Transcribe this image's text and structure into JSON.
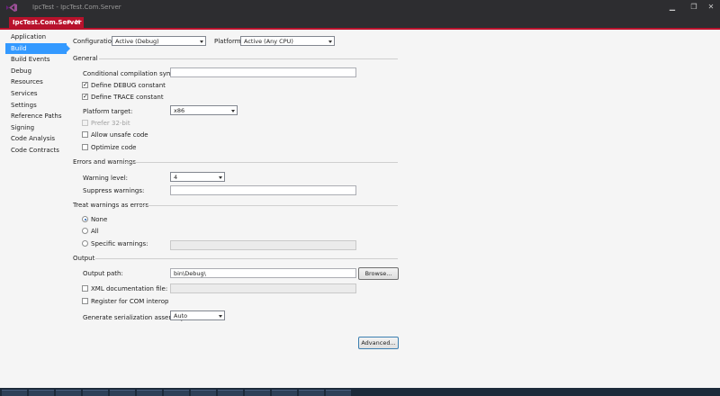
{
  "window": {
    "title": "IpcTest - IpcTest.Com.Server",
    "minimize": "▁",
    "maximize": "❐",
    "close": "✕"
  },
  "tab": {
    "label": "IpcTest.Com.Server",
    "pin": "⊕",
    "close": "✕"
  },
  "nav": {
    "items": [
      {
        "label": "Application"
      },
      {
        "label": "Build"
      },
      {
        "label": "Build Events"
      },
      {
        "label": "Debug"
      },
      {
        "label": "Resources"
      },
      {
        "label": "Services"
      },
      {
        "label": "Settings"
      },
      {
        "label": "Reference Paths"
      },
      {
        "label": "Signing"
      },
      {
        "label": "Code Analysis"
      },
      {
        "label": "Code Contracts"
      }
    ],
    "selected": "Build"
  },
  "config": {
    "configuration_label": "Configuration:",
    "configuration_value": "Active (Debug)",
    "platform_label": "Platform:",
    "platform_value": "Active (Any CPU)"
  },
  "general": {
    "header": "General",
    "conditional_label": "Conditional compilation symbols:",
    "conditional_value": "",
    "define_debug_label": "Define DEBUG constant",
    "define_debug_checked": true,
    "define_trace_label": "Define TRACE constant",
    "define_trace_checked": true,
    "platform_target_label": "Platform target:",
    "platform_target_value": "x86",
    "prefer32_label": "Prefer 32-bit",
    "prefer32_checked": false,
    "unsafe_label": "Allow unsafe code",
    "unsafe_checked": false,
    "optimize_label": "Optimize code",
    "optimize_checked": false
  },
  "errors": {
    "header": "Errors and warnings",
    "warning_level_label": "Warning level:",
    "warning_level_value": "4",
    "suppress_label": "Suppress warnings:",
    "suppress_value": ""
  },
  "treat": {
    "header": "Treat warnings as errors",
    "none_label": "None",
    "all_label": "All",
    "specific_label": "Specific warnings:",
    "specific_value": "",
    "selected": "None"
  },
  "output": {
    "header": "Output",
    "path_label": "Output path:",
    "path_value": "bin\\Debug\\",
    "browse_label": "Browse...",
    "xmldoc_label": "XML documentation file:",
    "xmldoc_checked": false,
    "xmldoc_value": "",
    "com_label": "Register for COM interop",
    "com_checked": false,
    "serialization_label": "Generate serialization assembly:",
    "serialization_value": "Auto",
    "advanced_label": "Advanced..."
  },
  "colors": {
    "accent": "#b8122c",
    "selection": "#3399ff",
    "chrome": "#2d2d30",
    "panel": "#f5f5f5"
  }
}
